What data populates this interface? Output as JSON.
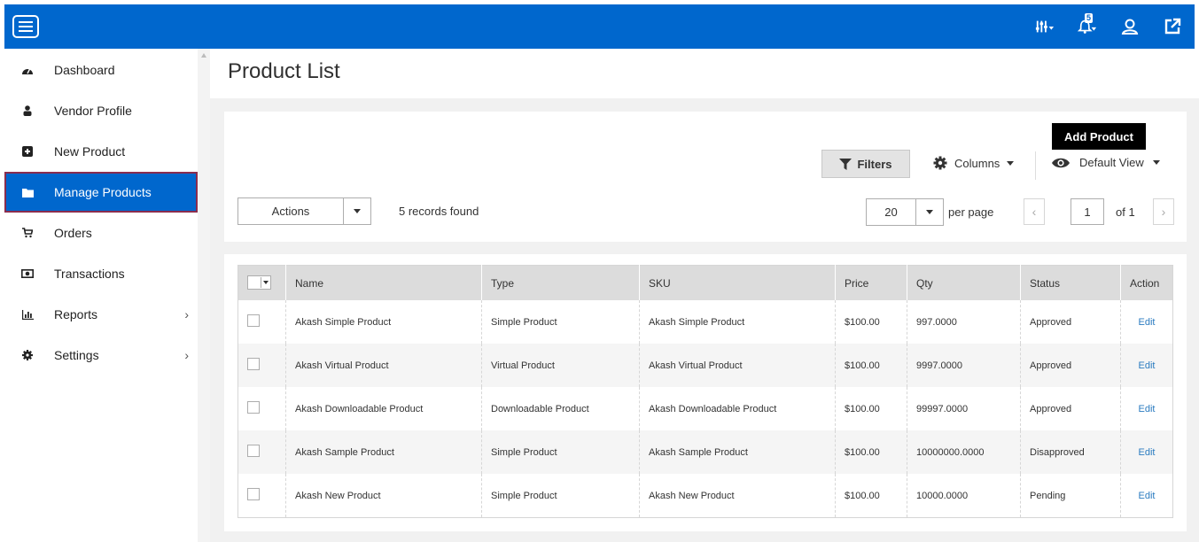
{
  "topbar": {
    "notification_count": "5",
    "icons": [
      "sliders-icon",
      "bell-icon",
      "user-icon",
      "external-link-icon"
    ]
  },
  "sidebar": {
    "items": [
      {
        "label": "Dashboard",
        "icon": "dashboard-icon"
      },
      {
        "label": "Vendor Profile",
        "icon": "user-icon"
      },
      {
        "label": "New Product",
        "icon": "plus-square-icon"
      },
      {
        "label": "Manage Products",
        "icon": "folder-icon",
        "active": true
      },
      {
        "label": "Orders",
        "icon": "cart-icon"
      },
      {
        "label": "Transactions",
        "icon": "money-icon"
      },
      {
        "label": "Reports",
        "icon": "bar-chart-icon",
        "chevron": "›"
      },
      {
        "label": "Settings",
        "icon": "gear-icon",
        "chevron": "›"
      }
    ]
  },
  "main": {
    "title": "Product List",
    "toolbar": {
      "add_product": "Add Product",
      "filters": "Filters",
      "columns": "Columns",
      "default_view": "Default View",
      "actions": "Actions",
      "records_found": "5 records found",
      "per_page_value": "20",
      "per_page_label": "per page",
      "page_prev": "‹",
      "page_next": "›",
      "page_current": "1",
      "page_of": "of 1"
    },
    "grid": {
      "headers": [
        "Name",
        "Type",
        "SKU",
        "Price",
        "Qty",
        "Status",
        "Action"
      ],
      "rows": [
        [
          "Akash Simple Product",
          "Simple Product",
          "Akash Simple Product",
          "$100.00",
          "997.0000",
          "Approved",
          "Edit"
        ],
        [
          "Akash Virtual Product",
          "Virtual Product",
          "Akash Virtual Product",
          "$100.00",
          "9997.0000",
          "Approved",
          "Edit"
        ],
        [
          "Akash Downloadable Product",
          "Downloadable Product",
          "Akash Downloadable Product",
          "$100.00",
          "99997.0000",
          "Approved",
          "Edit"
        ],
        [
          "Akash Sample Product",
          "Simple Product",
          "Akash Sample Product",
          "$100.00",
          "10000000.0000",
          "Disapproved",
          "Edit"
        ],
        [
          "Akash New Product",
          "Simple Product",
          "Akash New Product",
          "$100.00",
          "10000.0000",
          "Pending",
          "Edit"
        ]
      ]
    }
  },
  "colors": {
    "accent": "#0067cd",
    "active_border": "#8a2d4e",
    "link": "#2a7bc0"
  }
}
